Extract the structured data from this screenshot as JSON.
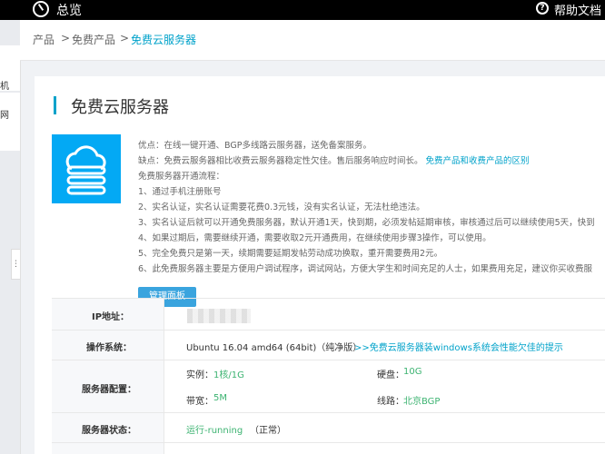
{
  "topbar": {
    "title": "总览",
    "help": "帮助文档"
  },
  "leftbar": {
    "item1": "机",
    "item2": "网",
    "handle": "⋮"
  },
  "breadcrumb": {
    "item1": "产品",
    "sep": ">",
    "item2": "免费产品",
    "item3": "免费云服务器"
  },
  "page": {
    "title": "免费云服务器"
  },
  "description": {
    "line1": "优点：在线一键开通、BGP多线路云服务器，送免备案服务。",
    "line2_prefix": "缺点：免费云服务器相比收费云服务器稳定性欠佳。售后服务响应时间长。",
    "line2_link": "免费产品和收费产品的区别",
    "line3": "免费服务器开通流程：",
    "line4": "1、通过手机注册账号",
    "line5": "2、实名认证，实名认证需要花费0.3元钱，没有实名认证，无法杜绝违法。",
    "line6": "3、实名认证后就可以开通免费服务器，默认开通1天，快到期，必须发帖延期审核，审核通过后可以继续使用5天，快到",
    "line7": "4、如果过期后，需要继续开通，需要收取2元开通费用，在继续使用步骤3操作，可以使用。",
    "line8": "5、完全免费只是第一天，续期需要延期发帖劳动成功换取，重开需要费用2元。",
    "line9": "6、此免费服务器主要是方便用户调试程序，调试网站，方便大学生和时间充足的人士，如果费用充足，建议你买收费服"
  },
  "manage_button": "管理面板",
  "table": {
    "ip_label": "IP地址：",
    "os_label": "操作系统：",
    "os_value": "Ubuntu 16.04 amd64 (64bit)（纯净版）",
    "os_link": ">>免费云服务器装windows系统会性能欠佳的提示",
    "config_label": "服务器配置：",
    "instance_label": "实例：",
    "instance_value": "1核/1G",
    "disk_label": "硬盘：",
    "disk_value": "10G",
    "bandwidth_label": "带宽：",
    "bandwidth_value": "5M",
    "line_label": "线路：",
    "line_value": "北京BGP",
    "status_label": "服务器状态：",
    "status_value": "运行-running",
    "status_note": "（正常）"
  }
}
